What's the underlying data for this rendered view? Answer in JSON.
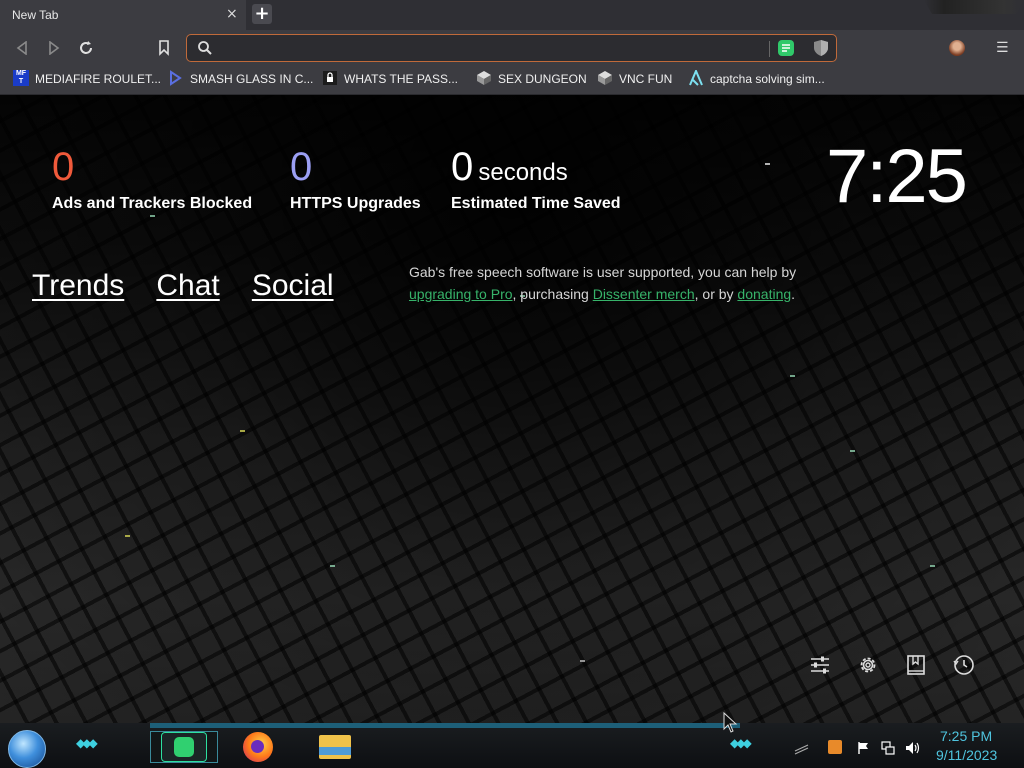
{
  "tab": {
    "title": "New Tab",
    "close_glyph": "×",
    "new_tab_glyph": "+"
  },
  "toolbar": {
    "back_icon": "back-arrow-icon",
    "forward_icon": "forward-arrow-icon",
    "reload_icon": "reload-icon",
    "bookmark_icon": "bookmark-icon",
    "address_value": "",
    "menu_glyph": "☰"
  },
  "bookmarks": [
    {
      "label": "MEDIAFIRE ROULET...",
      "icon": "mediafire-icon"
    },
    {
      "label": "SMASH GLASS IN C...",
      "icon": "bracket-icon"
    },
    {
      "label": "WHATS THE PASS...",
      "icon": "lock-icon"
    },
    {
      "label": "SEX DUNGEON",
      "icon": "cube-icon"
    },
    {
      "label": "VNC FUN",
      "icon": "cube-icon"
    },
    {
      "label": "captcha solving sim...",
      "icon": "lambda-icon"
    }
  ],
  "stats": [
    {
      "value": "0",
      "unit": "",
      "label": "Ads and Trackers Blocked",
      "color": "#f05a3b"
    },
    {
      "value": "0",
      "unit": "",
      "label": "HTTPS Upgrades",
      "color": "#9b9ff3"
    },
    {
      "value": "0",
      "unit": "seconds",
      "label": "Estimated Time Saved",
      "color": "#ffffff"
    }
  ],
  "clock": "7:25",
  "nav_links": [
    "Trends",
    "Chat",
    "Social"
  ],
  "promo": {
    "text_1": "Gab's free speech software is user supported, you can help by ",
    "link_1": "upgrading to Pro",
    "text_2": ", purchasing ",
    "link_2": "Dissenter merch",
    "text_3": ", or by ",
    "link_3": "donating",
    "text_4": "."
  },
  "bottom_tools": [
    "customize-sliders-icon",
    "settings-gear-icon",
    "bookmarks-icon",
    "history-clock-icon"
  ],
  "taskbar": {
    "apps": [
      "gab-chat-app",
      "firefox-app",
      "file-explorer-app"
    ],
    "time": "7:25 PM",
    "date": "9/11/2023"
  },
  "colors": {
    "accent": "#c06a3a",
    "link_green": "#37b36a",
    "taskbar_text": "#4fc4de"
  }
}
